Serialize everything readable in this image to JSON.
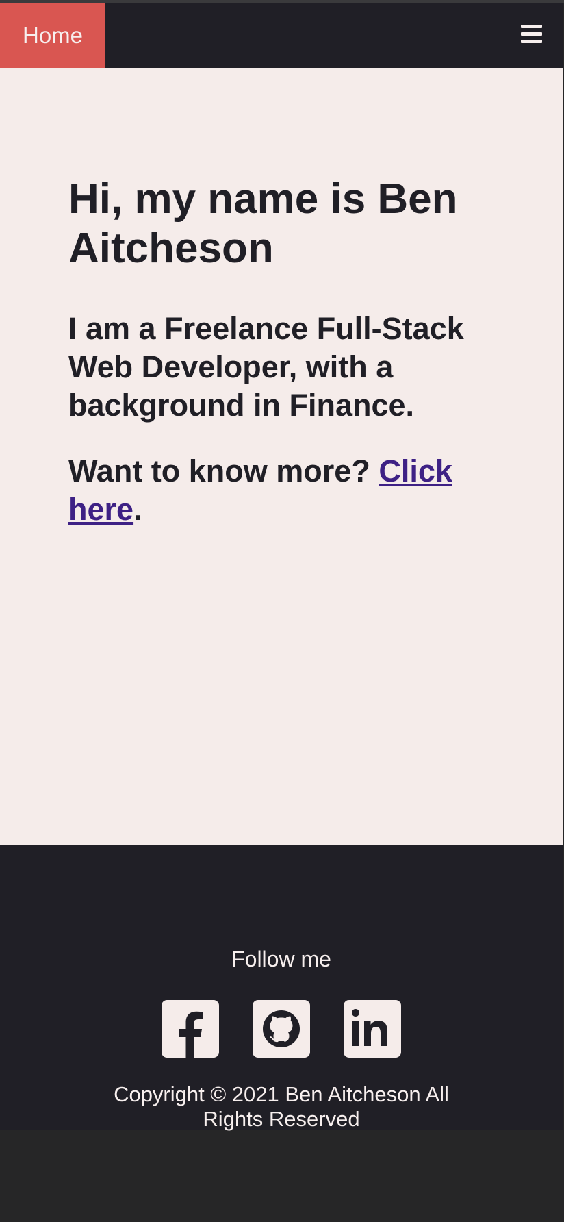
{
  "nav": {
    "home_label": "Home",
    "menu_icon": "hamburger-menu-icon"
  },
  "hero": {
    "title": "Hi, my name is Ben Aitcheson",
    "subtitle": "I am a Freelance Full-Stack Web Developer, with a background in Finance.",
    "cta_text": "Want to know more? ",
    "cta_link": "Click here",
    "cta_suffix": "."
  },
  "footer": {
    "follow_label": "Follow me",
    "socials": [
      {
        "name": "facebook",
        "icon": "facebook-icon"
      },
      {
        "name": "github",
        "icon": "github-icon"
      },
      {
        "name": "linkedin",
        "icon": "linkedin-icon"
      }
    ],
    "copyright": "Copyright © 2021 Ben Aitcheson All Rights Reserved"
  },
  "colors": {
    "nav_bg": "#201f26",
    "home_accent": "#d95651",
    "main_bg": "#f5ecea",
    "text_dark": "#201f26",
    "link": "#3e2185",
    "footer_text": "#f7efee",
    "page_bottom": "#262627"
  }
}
